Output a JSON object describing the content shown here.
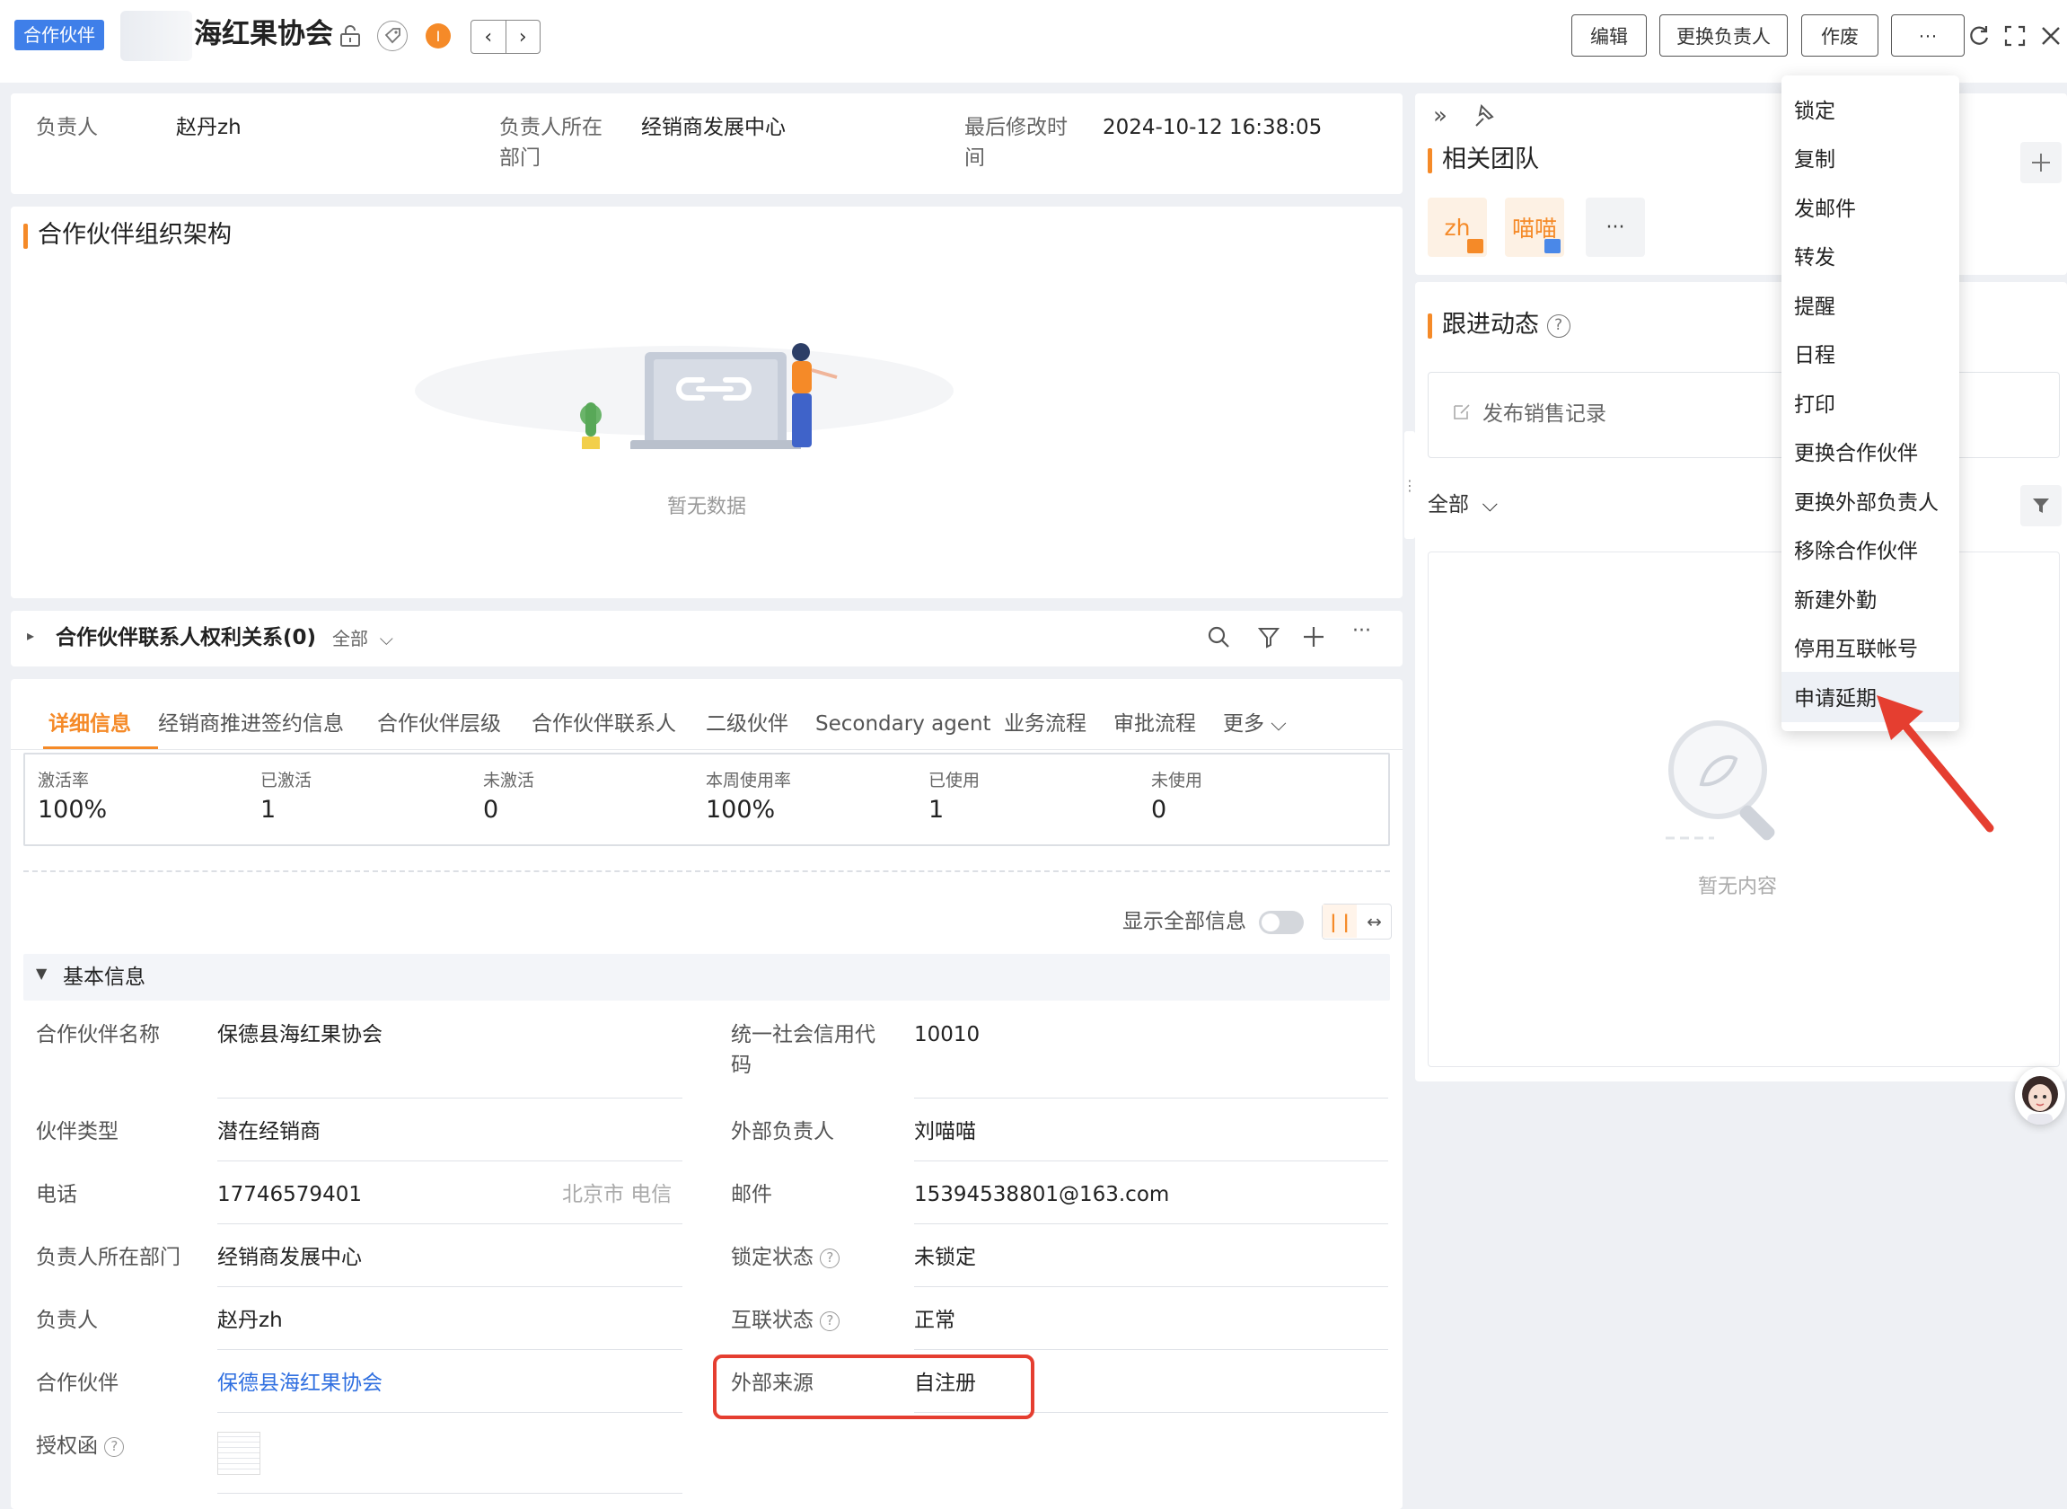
{
  "header": {
    "object_tag": "合作伙伴",
    "title": "海红果协会",
    "buttons": {
      "edit": "编辑",
      "change_owner": "更换负责人",
      "void": "作废",
      "more": "···"
    }
  },
  "owner_summary": {
    "owner_label": "负责人",
    "owner_value": "赵丹zh",
    "dept_label_line1": "负责人所在",
    "dept_label_line2": "部门",
    "dept_value": "经销商发展中心",
    "modified_label_line1": "最后修改时",
    "modified_label_line2": "间",
    "modified_value": "2024-10-12 16:38:05"
  },
  "org_structure": {
    "title": "合作伙伴组织架构",
    "empty_text": "暂无数据"
  },
  "relation": {
    "title": "合作伙伴联系人权利关系(0)",
    "filter_label": "全部"
  },
  "tabs": [
    {
      "label": "详细信息"
    },
    {
      "label": "经销商推进签约信息"
    },
    {
      "label": "合作伙伴层级"
    },
    {
      "label": "合作伙伴联系人"
    },
    {
      "label": "二级伙伴"
    },
    {
      "label": "Secondary agent"
    },
    {
      "label": "业务流程"
    },
    {
      "label": "审批流程"
    },
    {
      "label": "更多"
    }
  ],
  "stats": [
    {
      "label": "激活率",
      "value": "100%"
    },
    {
      "label": "已激活",
      "value": "1"
    },
    {
      "label": "未激活",
      "value": "0"
    },
    {
      "label": "本周使用率",
      "value": "100%"
    },
    {
      "label": "已使用",
      "value": "1"
    },
    {
      "label": "未使用",
      "value": "0"
    }
  ],
  "show_all_label": "显示全部信息",
  "basic_info": {
    "title": "基本信息",
    "fields": {
      "partner_name_label": "合作伙伴名称",
      "partner_name": "保德县海红果协会",
      "credit_code_label_line1": "统一社会信用代",
      "credit_code_label_line2": "码",
      "credit_code": "10010",
      "partner_type_label": "伙伴类型",
      "partner_type": "潜在经销商",
      "ext_owner_label": "外部负责人",
      "ext_owner": "刘喵喵",
      "phone_label": "电话",
      "phone": "17746579401",
      "phone_region": "北京市 电信",
      "email_label": "邮件",
      "email": "15394538801@163.com",
      "dept_label": "负责人所在部门",
      "dept": "经销商发展中心",
      "lock_label": "锁定状态",
      "lock": "未锁定",
      "owner_label": "负责人",
      "owner": "赵丹zh",
      "interconnect_label": "互联状态",
      "interconnect": "正常",
      "partner_label": "合作伙伴",
      "partner": "保德县海红果协会",
      "ext_source_label": "外部来源",
      "ext_source": "自注册",
      "auth_letter_label": "授权函"
    }
  },
  "team": {
    "title": "相关团队",
    "members": [
      {
        "label": "zh"
      },
      {
        "label": "喵喵"
      }
    ],
    "more": "···"
  },
  "followup": {
    "title": "跟进动态",
    "publish_placeholder": "发布销售记录",
    "filter_label": "全部",
    "empty_text": "暂无内容"
  },
  "more_menu": [
    "锁定",
    "复制",
    "发邮件",
    "转发",
    "提醒",
    "日程",
    "打印",
    "更换合作伙伴",
    "更换外部负责人",
    "移除合作伙伴",
    "新建外勤",
    "停用互联帐号",
    "申请延期"
  ],
  "colors": {
    "accent": "#f58a28",
    "link": "#2f6fe0",
    "tag": "#3f7fe9",
    "annotation": "#e53e30"
  }
}
